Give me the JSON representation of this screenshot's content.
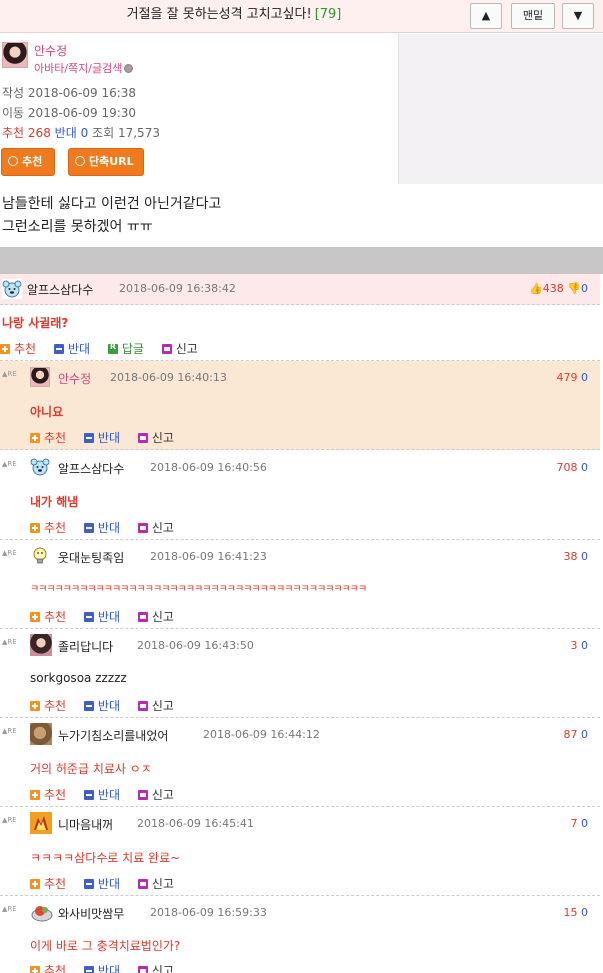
{
  "topbar": {
    "title": "거절을 잘 못하는성격 고치고싶다!",
    "comment_count": "[79]",
    "up_label": "▲",
    "bottom_label": "맨밑",
    "down_label": "▼"
  },
  "post": {
    "author": "안수정",
    "author_links": "아바타/쪽지/글검색",
    "written_label": "작성",
    "written_date": "2018-06-09 16:38",
    "moved_label": "이동",
    "moved_date": "2018-06-09 19:30",
    "recommend_label": "추천",
    "recommend_count": "268",
    "oppose_label": "반대",
    "oppose_count": "0",
    "views_label": "조회",
    "views_count": "17,573",
    "btn_recommend": "추천",
    "btn_shorturl": "단축URL",
    "body_lines": [
      "남들한테 싫다고 이런건 아닌거같다고",
      "그런소리를 못하겠어 ㅠㅠ"
    ]
  },
  "actions": {
    "recommend": "추천",
    "oppose": "반대",
    "reply": "답글",
    "report": "신고"
  },
  "comments": [
    {
      "name": "알프스삼다수",
      "date": "2018-06-09 16:38:42",
      "up": "438",
      "down": "0",
      "text": "나랑 사귈래?"
    },
    {
      "name": "안수정",
      "date": "2018-06-09 16:40:13",
      "up": "479",
      "down": "0",
      "text": "아니요"
    },
    {
      "name": "알프스삼다수",
      "date": "2018-06-09 16:40:56",
      "up": "708",
      "down": "0",
      "text": "내가 해냄"
    },
    {
      "name": "웃대눈팅족임",
      "date": "2018-06-09 16:41:23",
      "up": "38",
      "down": "0",
      "text": "ㅋㅋㅋㅋㅋㅋㅋㅋㅋㅋㅋㅋㅋㅋㅋㅋㅋㅋㅋㅋㅋㅋㅋㅋㅋㅋㅋㅋㅋㅋㅋㅋㅋㅋㅋㅋㅋㅋㅋㅋㅋ"
    },
    {
      "name": "졸리답니다",
      "date": "2018-06-09 16:43:50",
      "up": "3",
      "down": "0",
      "text": "sorkgosoa zzzzz"
    },
    {
      "name": "누가기침소리를내었어",
      "date": "2018-06-09 16:44:12",
      "up": "87",
      "down": "0",
      "text": "거의 허준급 치료사 ㅇㅈ"
    },
    {
      "name": "니마음내꺼",
      "date": "2018-06-09 16:45:41",
      "up": "7",
      "down": "0",
      "text": "ㅋㅋㅋㅋ삼다수로 치료 완료~"
    },
    {
      "name": "와사비맛쌈무",
      "date": "2018-06-09 16:59:33",
      "up": "15",
      "down": "0",
      "text": "이게 바로 그 충격치료법인가?"
    }
  ]
}
